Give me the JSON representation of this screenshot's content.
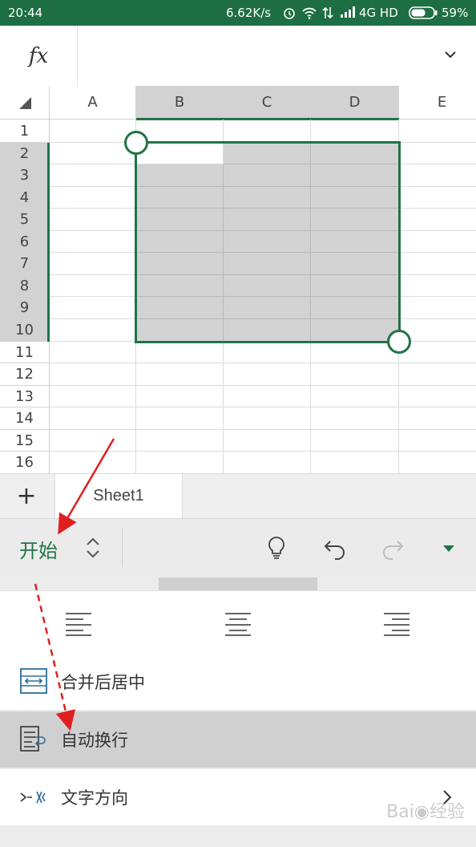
{
  "status_bar": {
    "time": "20:44",
    "net_speed": "6.62K/s",
    "network_type": "4G HD",
    "battery": "59%"
  },
  "formula_bar": {
    "fx_label": "fx",
    "value": ""
  },
  "columns": [
    "A",
    "B",
    "C",
    "D",
    "E"
  ],
  "rows": [
    "1",
    "2",
    "3",
    "4",
    "5",
    "6",
    "7",
    "8",
    "9",
    "10",
    "11",
    "12",
    "13",
    "14",
    "15",
    "16"
  ],
  "selection": {
    "range": "B2:D10"
  },
  "sheets": {
    "add_label": "+",
    "tabs": [
      "Sheet1"
    ]
  },
  "ribbon": {
    "title": "开始"
  },
  "panel": {
    "menu_items": [
      {
        "label": "合并后居中",
        "icon": "merge-center-icon"
      },
      {
        "label": "自动换行",
        "icon": "wrap-text-icon"
      },
      {
        "label": "文字方向",
        "icon": "text-direction-icon"
      }
    ]
  },
  "colors": {
    "status_bar": "#1e6e43",
    "accent": "#217346",
    "annotation": "#e02020"
  }
}
